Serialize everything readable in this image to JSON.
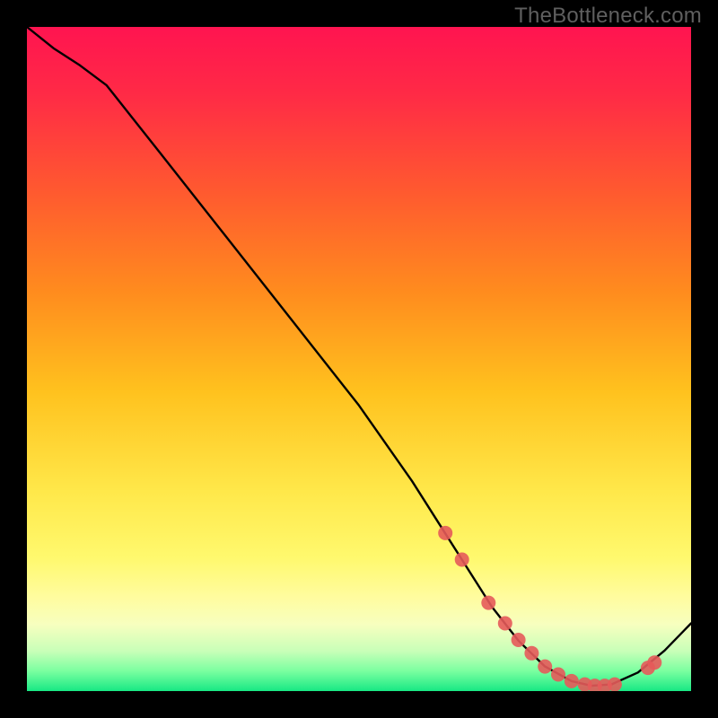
{
  "watermark": "TheBottleneck.com",
  "chart_data": {
    "type": "line",
    "title": "",
    "xlabel": "",
    "ylabel": "",
    "xlim": [
      0,
      100
    ],
    "ylim": [
      0,
      100
    ],
    "series": [
      {
        "name": "curve",
        "x": [
          0,
          4,
          8,
          12,
          20,
          30,
          40,
          50,
          58,
          62,
          66,
          70,
          74,
          78,
          82,
          85,
          88,
          92,
          96,
          100
        ],
        "y": [
          100,
          96.8,
          94.2,
          91.2,
          81.1,
          68.4,
          55.7,
          43.0,
          31.6,
          25.3,
          19.0,
          12.7,
          7.6,
          3.7,
          1.5,
          0.8,
          1.0,
          2.8,
          6.1,
          10.2
        ]
      }
    ],
    "markers": {
      "name": "trough-markers",
      "x": [
        63.0,
        65.5,
        69.5,
        72.0,
        74.0,
        76.0,
        78.0,
        80.0,
        82.0,
        84.0,
        85.5,
        87.0,
        88.5,
        93.5,
        94.5
      ],
      "y": [
        23.8,
        19.8,
        13.3,
        10.2,
        7.7,
        5.7,
        3.7,
        2.5,
        1.5,
        1.0,
        0.8,
        0.8,
        1.0,
        3.5,
        4.3
      ]
    },
    "gradient_stops": [
      {
        "offset": 0.0,
        "color": "#ff1450"
      },
      {
        "offset": 0.1,
        "color": "#ff2a46"
      },
      {
        "offset": 0.25,
        "color": "#ff5a2f"
      },
      {
        "offset": 0.4,
        "color": "#ff8c1e"
      },
      {
        "offset": 0.55,
        "color": "#ffc21e"
      },
      {
        "offset": 0.7,
        "color": "#ffe84a"
      },
      {
        "offset": 0.8,
        "color": "#fff96e"
      },
      {
        "offset": 0.86,
        "color": "#fffca0"
      },
      {
        "offset": 0.9,
        "color": "#f7ffbf"
      },
      {
        "offset": 0.94,
        "color": "#c8ffb8"
      },
      {
        "offset": 0.97,
        "color": "#7affa0"
      },
      {
        "offset": 1.0,
        "color": "#18e884"
      }
    ]
  }
}
